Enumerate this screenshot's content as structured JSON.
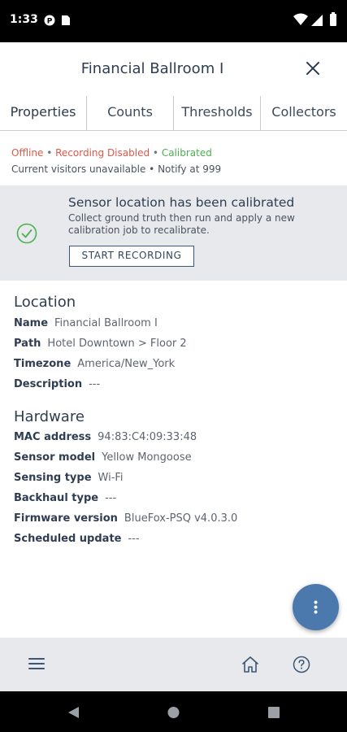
{
  "status_bar": {
    "time": "1:33",
    "icons": [
      "notification-icon",
      "sim-card-icon",
      "wifi-icon",
      "signal-icon",
      "battery-icon"
    ]
  },
  "header": {
    "title": "Financial Ballroom I",
    "close_icon": "close-icon"
  },
  "tabs": [
    {
      "label": "Properties"
    },
    {
      "label": "Counts"
    },
    {
      "label": "Thresholds"
    },
    {
      "label": "Collectors"
    }
  ],
  "status": {
    "offline": "Offline",
    "recording": "Recording Disabled",
    "calibrated": "Calibrated",
    "bullet": "•",
    "visitors": "Current visitors unavailable",
    "notify": "Notify at 999"
  },
  "banner": {
    "title": "Sensor location has been calibrated",
    "text": "Collect ground truth then run and apply a new calibration job to recalibrate.",
    "button": "START RECORDING"
  },
  "location": {
    "title": "Location",
    "rows": [
      {
        "label": "Name",
        "value": "Financial Ballroom I"
      },
      {
        "label": "Path",
        "value": "Hotel Downtown > Floor 2"
      },
      {
        "label": "Timezone",
        "value": "America/New_York"
      },
      {
        "label": "Description",
        "value": "---"
      }
    ]
  },
  "hardware": {
    "title": "Hardware",
    "rows": [
      {
        "label": "MAC address",
        "value": "94:83:C4:09:33:48"
      },
      {
        "label": "Sensor model",
        "value": "Yellow Mongoose"
      },
      {
        "label": "Sensing type",
        "value": "Wi-Fi"
      },
      {
        "label": "Backhaul type",
        "value": "---"
      },
      {
        "label": "Firmware version",
        "value": "BlueFox-PSQ v4.0.3.0"
      },
      {
        "label": "Scheduled update",
        "value": "---"
      }
    ]
  },
  "colors": {
    "accent": "#4b78ad",
    "error": "#e0574a",
    "success": "#4caf50",
    "text": "#2f3d52"
  }
}
